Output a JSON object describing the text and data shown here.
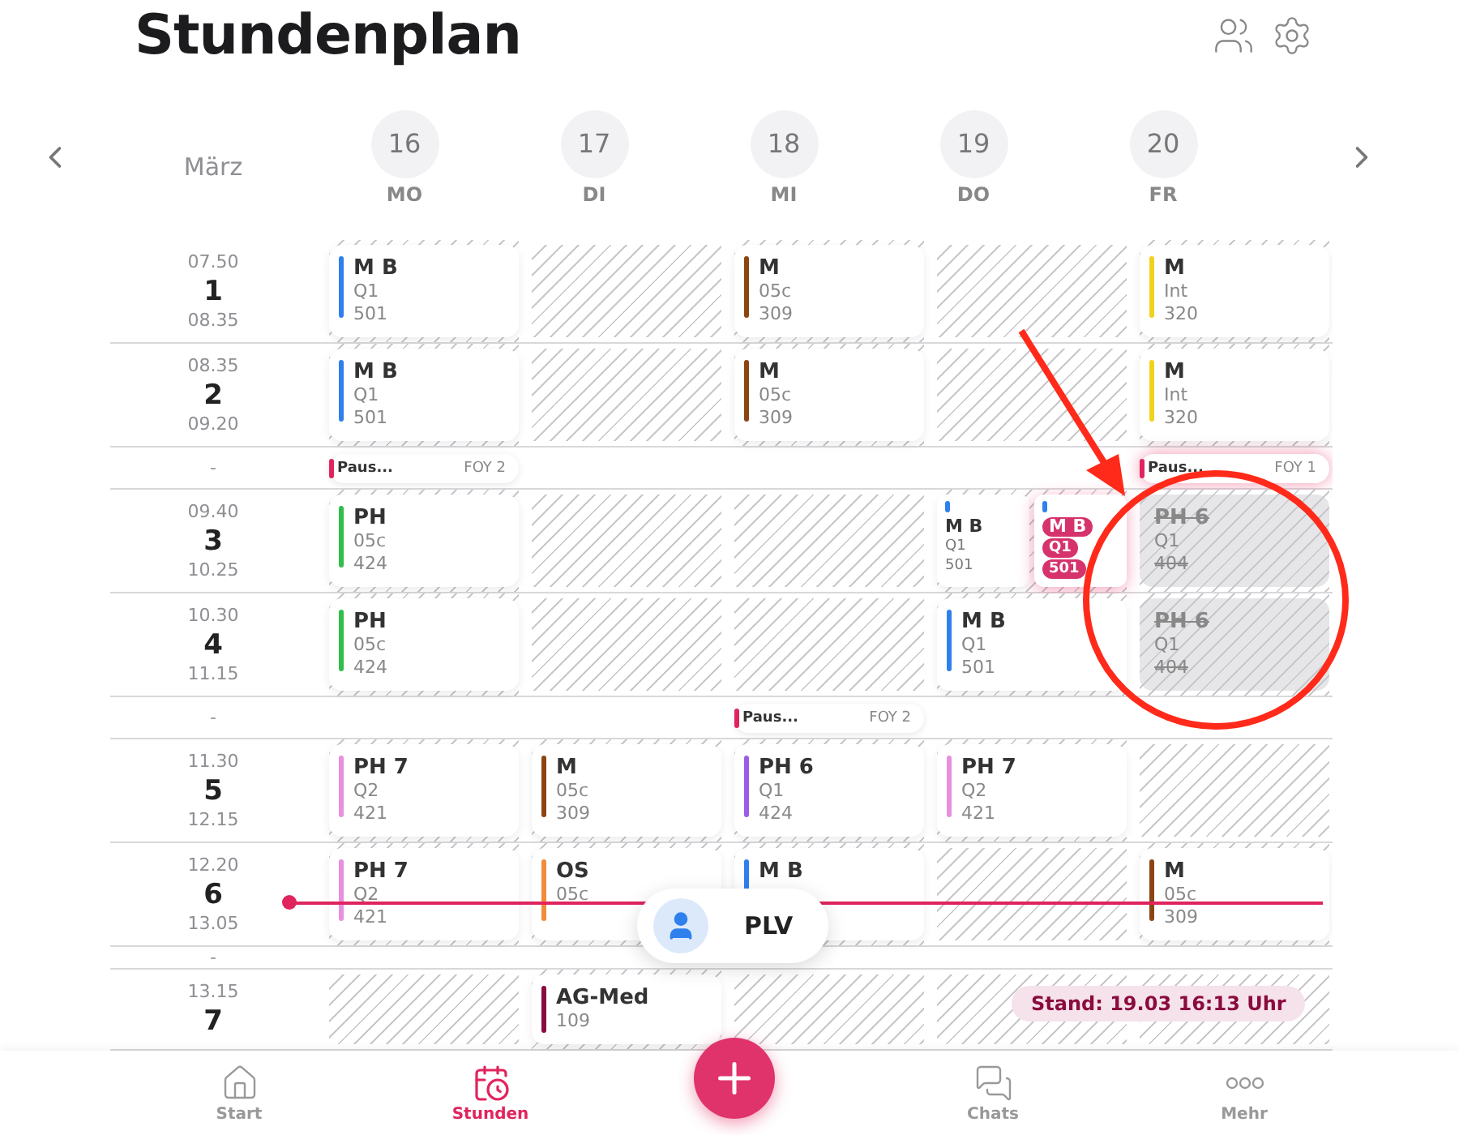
{
  "header": {
    "title": "Stundenplan"
  },
  "week": {
    "month": "März",
    "days": [
      {
        "date": "16",
        "weekday": "MO"
      },
      {
        "date": "17",
        "weekday": "DI"
      },
      {
        "date": "18",
        "weekday": "MI"
      },
      {
        "date": "19",
        "weekday": "DO"
      },
      {
        "date": "20",
        "weekday": "FR"
      }
    ]
  },
  "periods": [
    {
      "kind": "lesson",
      "number": "1",
      "start": "07.50",
      "end": "08.35",
      "current": false,
      "cells": [
        {
          "kind": "lesson",
          "subject": "M B",
          "class": "Q1",
          "room": "501",
          "color": "#2f80ed"
        },
        {
          "kind": "free"
        },
        {
          "kind": "lesson",
          "subject": "M",
          "class": "05c",
          "room": "309",
          "color": "#8b4513"
        },
        {
          "kind": "free"
        },
        {
          "kind": "lesson",
          "subject": "M",
          "class": "Int",
          "room": "320",
          "color": "#f2d21b"
        }
      ]
    },
    {
      "kind": "lesson",
      "number": "2",
      "start": "08.35",
      "end": "09.20",
      "current": false,
      "cells": [
        {
          "kind": "lesson",
          "subject": "M B",
          "class": "Q1",
          "room": "501",
          "color": "#2f80ed"
        },
        {
          "kind": "free"
        },
        {
          "kind": "lesson",
          "subject": "M",
          "class": "05c",
          "room": "309",
          "color": "#8b4513"
        },
        {
          "kind": "free"
        },
        {
          "kind": "lesson",
          "subject": "M",
          "class": "Int",
          "room": "320",
          "color": "#f2d21b"
        }
      ]
    },
    {
      "kind": "break",
      "label": "-",
      "cells": [
        {
          "kind": "pause",
          "label": "Paus...",
          "room": "FOY 2",
          "highlighted": false
        },
        {
          "kind": "none"
        },
        {
          "kind": "none"
        },
        {
          "kind": "none"
        },
        {
          "kind": "pause",
          "label": "Paus...",
          "room": "FOY 1",
          "highlighted": true
        }
      ]
    },
    {
      "kind": "lesson",
      "number": "3",
      "start": "09.40",
      "end": "10.25",
      "current": false,
      "cells": [
        {
          "kind": "lesson",
          "subject": "PH",
          "class": "05c",
          "room": "424",
          "color": "#2fbf4a"
        },
        {
          "kind": "free"
        },
        {
          "kind": "free"
        },
        {
          "kind": "split",
          "parts": [
            {
              "subject": "M B",
              "class": "Q1",
              "room": "501",
              "color": "#2f80ed",
              "highlighted": false
            },
            {
              "subject": "M B",
              "class": "Q1",
              "room": "501",
              "color": "#2f80ed",
              "highlighted": true
            }
          ]
        },
        {
          "kind": "cancelled",
          "subject": "PH 6",
          "class": "Q1",
          "room": "404"
        }
      ]
    },
    {
      "kind": "lesson",
      "number": "4",
      "start": "10.30",
      "end": "11.15",
      "current": false,
      "cells": [
        {
          "kind": "lesson",
          "subject": "PH",
          "class": "05c",
          "room": "424",
          "color": "#2fbf4a"
        },
        {
          "kind": "free"
        },
        {
          "kind": "free"
        },
        {
          "kind": "lesson",
          "subject": "M B",
          "class": "Q1",
          "room": "501",
          "color": "#2f80ed"
        },
        {
          "kind": "cancelled",
          "subject": "PH 6",
          "class": "Q1",
          "room": "404"
        }
      ]
    },
    {
      "kind": "break",
      "label": "-",
      "cells": [
        {
          "kind": "none"
        },
        {
          "kind": "none"
        },
        {
          "kind": "pause",
          "label": "Paus...",
          "room": "FOY 2",
          "highlighted": false
        },
        {
          "kind": "none"
        },
        {
          "kind": "none"
        }
      ]
    },
    {
      "kind": "lesson",
      "number": "5",
      "start": "11.30",
      "end": "12.15",
      "current": false,
      "cells": [
        {
          "kind": "lesson",
          "subject": "PH 7",
          "class": "Q2",
          "room": "421",
          "color": "#e88fe0"
        },
        {
          "kind": "lesson",
          "subject": "M",
          "class": "05c",
          "room": "309",
          "color": "#8b4513"
        },
        {
          "kind": "lesson",
          "subject": "PH 6",
          "class": "Q1",
          "room": "424",
          "color": "#9b5de5"
        },
        {
          "kind": "lesson",
          "subject": "PH 7",
          "class": "Q2",
          "room": "421",
          "color": "#e88fe0"
        },
        {
          "kind": "free"
        }
      ]
    },
    {
      "kind": "lesson",
      "number": "6",
      "start": "12.20",
      "end": "13.05",
      "current": true,
      "cells": [
        {
          "kind": "lesson",
          "subject": "PH 7",
          "class": "Q2",
          "room": "421",
          "color": "#e88fe0"
        },
        {
          "kind": "lesson",
          "subject": "OS",
          "class": "05c",
          "color": "#f08c3a"
        },
        {
          "kind": "lesson",
          "subject": "M B",
          "color": "#2f80ed"
        },
        {
          "kind": "free"
        },
        {
          "kind": "lesson",
          "subject": "M",
          "class": "05c",
          "room": "309",
          "color": "#8b4513"
        }
      ]
    },
    {
      "kind": "break",
      "label": "-",
      "cells": [
        {
          "kind": "none"
        },
        {
          "kind": "none"
        },
        {
          "kind": "none"
        },
        {
          "kind": "none"
        },
        {
          "kind": "none"
        }
      ]
    },
    {
      "kind": "lesson",
      "number": "7",
      "start": "13.15",
      "current": false,
      "cells": [
        {
          "kind": "free"
        },
        {
          "kind": "lesson",
          "subject": "AG-Med",
          "room": "109",
          "color": "#8a0b3f"
        },
        {
          "kind": "free"
        },
        {
          "kind": "free"
        },
        {
          "kind": "free"
        }
      ]
    }
  ],
  "teacher_pill": {
    "label": "PLV"
  },
  "status": "Stand: 19.03 16:13 Uhr",
  "nav": {
    "items": [
      {
        "label": "Start",
        "kind": "home",
        "selected": false
      },
      {
        "label": "Stunden",
        "kind": "calendar",
        "selected": true
      },
      {
        "label": "Chats",
        "kind": "chats",
        "selected": false
      },
      {
        "label": "Mehr",
        "kind": "more",
        "selected": false
      }
    ]
  }
}
